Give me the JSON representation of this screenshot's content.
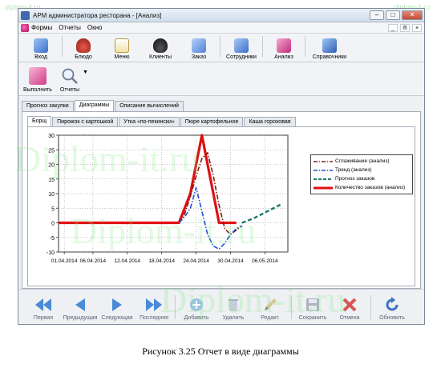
{
  "watermark": {
    "top_left": "diplom-it.ru",
    "top_right": "diplom-it.ru",
    "overlay": "Diplom-it.ru"
  },
  "window": {
    "title": "АРМ администратора ресторана - [Анализ]",
    "controls": {
      "minimize": "–",
      "maximize": "□",
      "close": "✕"
    }
  },
  "menu": {
    "items": [
      "Формы",
      "Отчеты",
      "Окно"
    ],
    "mdi": [
      "_",
      "ᗰ",
      "×"
    ]
  },
  "toolbar_main": {
    "buttons": [
      {
        "label": "Вход",
        "icon": "login-icon",
        "color": "#4b7fd6"
      },
      {
        "label": "Блюдо",
        "icon": "pot-icon",
        "color": "#c0392b"
      },
      {
        "label": "Меню",
        "icon": "menu-doc-icon",
        "color": "#d9b44a"
      },
      {
        "label": "Клиенты",
        "icon": "hat-icon",
        "color": "#222222"
      },
      {
        "label": "Заказ",
        "icon": "order-pencil-icon",
        "color": "#5d8fe0"
      },
      {
        "label": "Сотрудники",
        "icon": "employees-icon",
        "color": "#4b7fd6"
      },
      {
        "label": "Анализ",
        "icon": "analysis-icon",
        "color": "#d43f8d"
      },
      {
        "label": "Справочники",
        "icon": "reference-book-icon",
        "color": "#3d73c5"
      }
    ]
  },
  "toolbar_secondary": {
    "buttons": [
      {
        "label": "Выполнить",
        "icon": "run-icon"
      },
      {
        "label": "Отчеты",
        "icon": "magnifier-icon"
      }
    ]
  },
  "tabs_main": [
    "Прогноз закупки",
    "Диаграммы",
    "Описание вычислений"
  ],
  "tabs_main_active": 1,
  "tabs_sub": [
    "Борщ",
    "Пирожок с картошкой",
    "Утка «по-пекински»",
    "Пюре картофельное",
    "Каша гороховая"
  ],
  "tabs_sub_active": 0,
  "chart_data": {
    "type": "line",
    "x_tick_labels": [
      "01.04.2014",
      "06.04.2014",
      "12.04.2014",
      "18.04.2014",
      "24.04.2014",
      "30.04.2014",
      "06.05.2014"
    ],
    "x_range": [
      "31.03.2014",
      "10.05.2014"
    ],
    "ylim": [
      -10,
      30
    ],
    "y_ticks": [
      -10,
      -5,
      0,
      5,
      10,
      15,
      20,
      25,
      30
    ],
    "grid": true,
    "legend_position": "right",
    "series": [
      {
        "name": "Сглаживание (анализ)",
        "color": "#8b1a1a",
        "dash": "dashdot",
        "points": [
          [
            "21.04.2014",
            0
          ],
          [
            "22.04.2014",
            3
          ],
          [
            "23.04.2014",
            9
          ],
          [
            "24.04.2014",
            16
          ],
          [
            "25.04.2014",
            22
          ],
          [
            "26.04.2014",
            24
          ],
          [
            "27.04.2014",
            16
          ],
          [
            "28.04.2014",
            6
          ],
          [
            "29.04.2014",
            -2
          ],
          [
            "30.04.2014",
            -4
          ],
          [
            "01.05.2014",
            -2.5
          ],
          [
            "02.05.2014",
            -1
          ]
        ]
      },
      {
        "name": "Тренд (анализ)",
        "color": "#1f4fd6",
        "dash": "dashdot",
        "points": [
          [
            "21.04.2014",
            0
          ],
          [
            "22.04.2014",
            2
          ],
          [
            "23.04.2014",
            5
          ],
          [
            "24.04.2014",
            12
          ],
          [
            "25.04.2014",
            4
          ],
          [
            "26.04.2014",
            -4
          ],
          [
            "27.04.2014",
            -8
          ],
          [
            "28.04.2014",
            -9
          ],
          [
            "29.04.2014",
            -7
          ],
          [
            "30.04.2014",
            -4
          ],
          [
            "01.05.2014",
            -2
          ],
          [
            "02.05.2014",
            -1
          ]
        ]
      },
      {
        "name": "Прогноз заказов",
        "color": "#1a7a6a",
        "dash": "dashed",
        "points": [
          [
            "02.05.2014",
            0
          ],
          [
            "04.05.2014",
            1.5
          ],
          [
            "06.05.2014",
            3.5
          ],
          [
            "08.05.2014",
            5.5
          ],
          [
            "09.05.2014",
            6.5
          ]
        ]
      },
      {
        "name": "Количество заказов (анализ)",
        "color": "#e01010",
        "dash": "solid",
        "points": [
          [
            "31.03.2014",
            0
          ],
          [
            "21.04.2014",
            0
          ],
          [
            "23.04.2014",
            10
          ],
          [
            "24.04.2014",
            20
          ],
          [
            "25.04.2014",
            30
          ],
          [
            "26.04.2014",
            20
          ],
          [
            "27.04.2014",
            10
          ],
          [
            "28.04.2014",
            0
          ],
          [
            "01.05.2014",
            0
          ]
        ]
      }
    ]
  },
  "nav_toolbar": {
    "buttons": [
      {
        "label": "Первая",
        "icon": "first-record-icon"
      },
      {
        "label": "Предыдущая",
        "icon": "previous-record-icon"
      },
      {
        "label": "Следующая",
        "icon": "next-record-icon"
      },
      {
        "label": "Последняя",
        "icon": "last-record-icon"
      },
      {
        "label": "Добавить",
        "icon": "add-icon"
      },
      {
        "label": "Удалить",
        "icon": "trash-icon"
      },
      {
        "label": "Редакт.",
        "icon": "edit-pencil-icon"
      },
      {
        "label": "Сохранить",
        "icon": "save-icon"
      },
      {
        "label": "Отмена",
        "icon": "cancel-icon"
      },
      {
        "label": "Обновить",
        "icon": "refresh-icon"
      }
    ]
  },
  "caption": "Рисунок 3.25 Отчет в виде диаграммы"
}
